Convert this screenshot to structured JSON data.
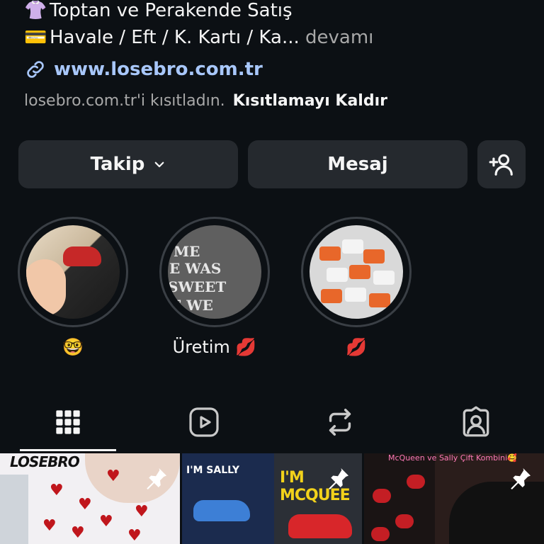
{
  "bio": {
    "line1_emoji": "👚",
    "line1": "Toptan ve Perakende Satış",
    "line2_emoji": "💳",
    "line2": "Havale / Eft / K. Kartı / Ka...",
    "more": "devamı"
  },
  "link": {
    "icon": "link-icon",
    "text": "www.losebro.com.tr"
  },
  "restriction": {
    "text": "losebro.com.tr'i kısıtladın.",
    "action": "Kısıtlamayı Kaldır"
  },
  "buttons": {
    "follow": "Takip",
    "message": "Mesaj",
    "add_icon": "add-person-icon"
  },
  "highlights": [
    {
      "label": "🤓"
    },
    {
      "label": "Üretim 💋"
    },
    {
      "label": "💋"
    }
  ],
  "highlight_texts": {
    "h2": [
      "ME",
      "E WAS",
      "SWEET",
      "E WE"
    ]
  },
  "tabs": [
    {
      "icon": "grid-icon",
      "active": true
    },
    {
      "icon": "reels-icon",
      "active": false
    },
    {
      "icon": "reposts-icon",
      "active": false
    },
    {
      "icon": "tagged-icon",
      "active": false
    }
  ],
  "posts": [
    {
      "overlay_text": "LOSEBRO",
      "pinned": true
    },
    {
      "overlay_text": "I'M SALLY",
      "overlay_text_2": "I'M MCQUEE",
      "pinned": true
    },
    {
      "overlay_text": "McQueen ve Sally Çift Kombini🥰",
      "pinned": true
    }
  ],
  "colors": {
    "background": "#0c1014",
    "button": "#25292e",
    "link": "#a8c7fa",
    "muted": "#a8a8a8"
  }
}
